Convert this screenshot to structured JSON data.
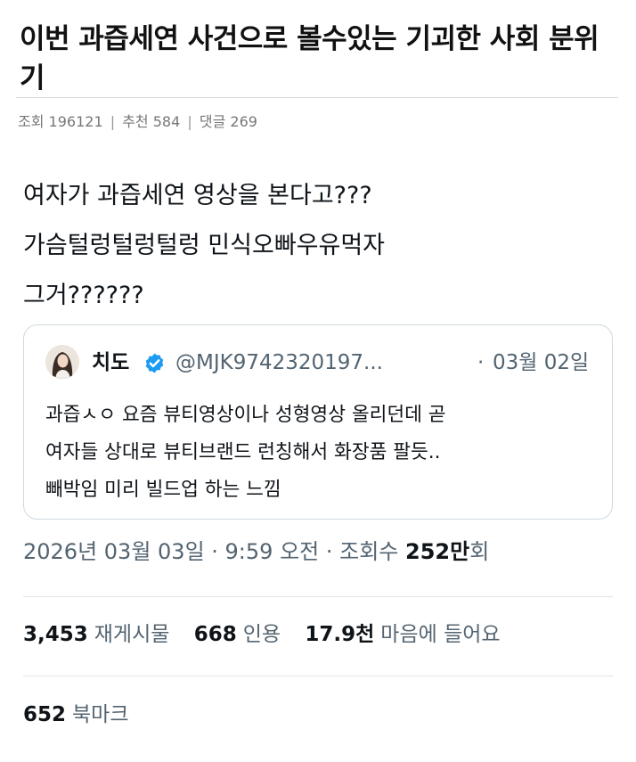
{
  "post": {
    "title": "이번 과즙세연 사건으로 볼수있는 기괴한 사회 분위기",
    "meta": {
      "views_label": "조회",
      "views": "196121",
      "recommend_label": "추천",
      "recommend": "584",
      "comments_label": "댓글",
      "comments": "269",
      "separator": "|"
    }
  },
  "tweet": {
    "lines": [
      "여자가 과즙세연 영상을 본다고???",
      "가슴털렁털렁털렁 민식오빠우유먹자",
      "그거??????"
    ],
    "quote": {
      "name": "치도",
      "handle": "@MJK9742320197...",
      "dot": "·",
      "date": "03월 02일",
      "lines": [
        "과즙ㅅㅇ 요즘 뷰티영상이나 성형영상 올리던데 곧",
        "여자들 상대로 뷰티브랜드 런칭해서 화장품 팔듯..",
        "빼박임 미리 빌드업 하는 느낌"
      ],
      "verified_icon": "verified-badge-icon",
      "verified_color": "#1d9bf0"
    },
    "timestamp": "2026년 03월 03일 · 9:59 오전 · 조회수",
    "views_count": "252만",
    "views_suffix": "회",
    "stats": {
      "retweets": {
        "value": "3,453",
        "label": "재게시물"
      },
      "quotes": {
        "value": "668",
        "label": "인용"
      },
      "likes": {
        "value": "17.9천",
        "label": "마음에 들어요"
      },
      "bookmarks": {
        "value": "652",
        "label": "북마크"
      }
    }
  }
}
